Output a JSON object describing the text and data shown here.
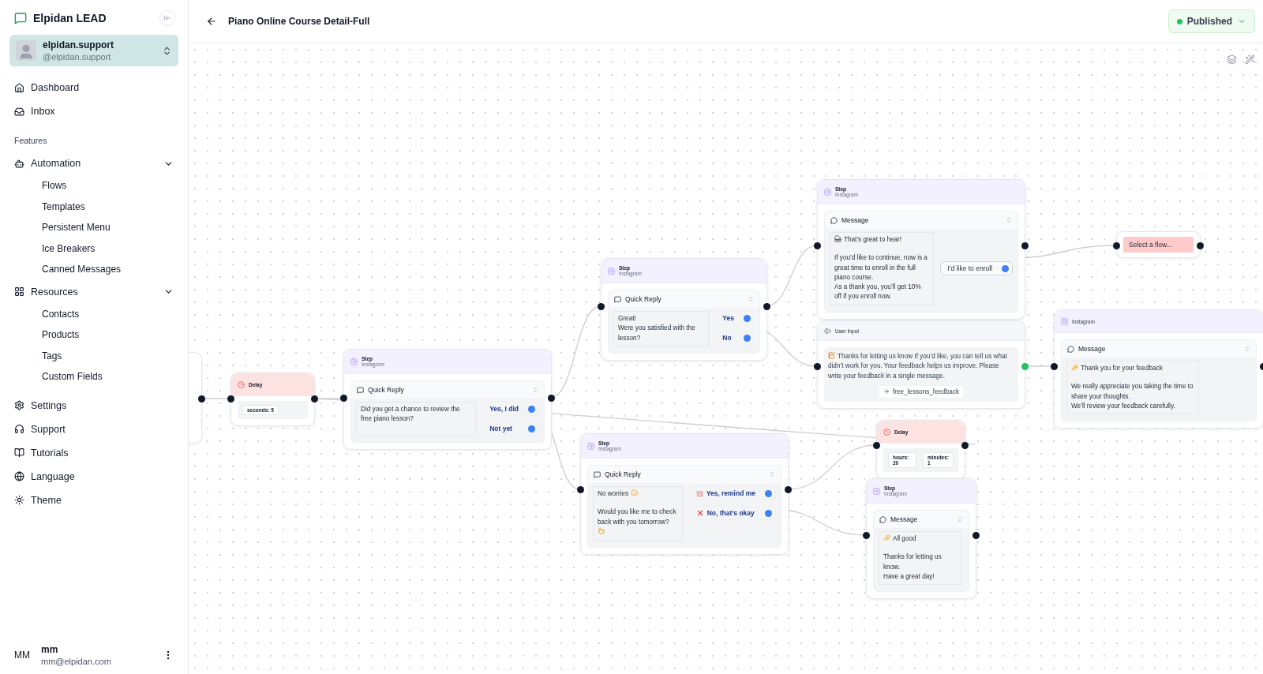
{
  "sidebar": {
    "brand": "Elpidan LEAD",
    "account": {
      "name": "elpidan.support",
      "handle": "@elpidan.support"
    },
    "top_items": [
      {
        "label": "Dashboard"
      },
      {
        "label": "Inbox"
      }
    ],
    "section": "Features",
    "groups": [
      {
        "label": "Automation",
        "expanded": true,
        "children": [
          "Flows",
          "Templates",
          "Persistent Menu",
          "Ice Breakers",
          "Canned Messages"
        ]
      },
      {
        "label": "Resources",
        "expanded": true,
        "children": [
          "Contacts",
          "Products",
          "Tags",
          "Custom Fields"
        ]
      }
    ],
    "bottom_items": [
      {
        "label": "Settings"
      },
      {
        "label": "Support"
      },
      {
        "label": "Tutorials"
      },
      {
        "label": "Language"
      },
      {
        "label": "Theme"
      }
    ],
    "user": {
      "initials": "MM",
      "name": "mm",
      "email": "mm@elpidan.com"
    }
  },
  "header": {
    "title": "Piano Online Course Detail-Full",
    "status": "Published"
  },
  "nodes": [
    {
      "kind": "delay",
      "title": "Delay",
      "values": [
        "seconds: 5"
      ]
    },
    {
      "kind": "step",
      "title": "Step",
      "channel": "Instagram",
      "block": "Quick Reply",
      "text": [
        "Did you get a chance to review the free piano lesson?"
      ],
      "buttons": [
        "Yes, I did",
        "Not yet"
      ]
    },
    {
      "kind": "step",
      "title": "Step",
      "channel": "Instagram",
      "block": "Quick Reply",
      "text": [
        "Great!\nWere you satisfied with the lesson?"
      ],
      "buttons": [
        "Yes",
        "No"
      ]
    },
    {
      "kind": "step",
      "title": "Step",
      "channel": "Instagram",
      "block": "Quick Reply",
      "text": [
        "No worries",
        "Would you like me to check back with you tomorrow?"
      ],
      "buttons": [
        "Yes, remind me",
        "No, that’s okay"
      ]
    },
    {
      "kind": "step",
      "title": "Step",
      "channel": "Instagram",
      "block": "Message",
      "text": [
        "That’s great to hear!",
        "If you’d like to continue, now is a great time to enroll in the full piano course.\nAs a thank you, you’ll get 10% off if you enroll now."
      ],
      "buttons": [
        "I’d like to enroll"
      ]
    },
    {
      "kind": "user_input",
      "title": "User Input",
      "text": "Thanks for letting us know If you’d like, you can tell us what didn’t work for you. Your feedback helps us improve. Please write your feedback in a single message.",
      "variable": "free_lessons_feedback"
    },
    {
      "kind": "flow_select",
      "placeholder": "Select a flow..."
    },
    {
      "kind": "step",
      "channel": "Instagram",
      "block": "Message",
      "text": [
        "Thank you for your feedback",
        "We really appreciate you taking the time to share your thoughts.\nWe’ll review your feedback carefully."
      ]
    },
    {
      "kind": "delay",
      "title": "Delay",
      "values": [
        "hours: 20",
        "minutes: 1"
      ]
    },
    {
      "kind": "step",
      "title": "Step",
      "channel": "Instagram",
      "block": "Message",
      "text": [
        "All good",
        "Thanks for letting us know.\nHave a great day!"
      ]
    }
  ]
}
